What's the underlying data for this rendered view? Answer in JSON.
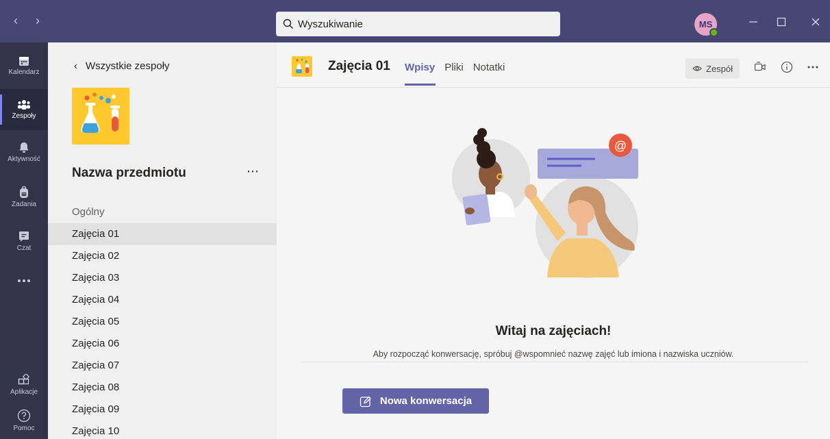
{
  "search": {
    "placeholder": "Wyszukiwanie"
  },
  "user": {
    "initials": "MS"
  },
  "rail": {
    "items": [
      {
        "label": "Kalendarz",
        "icon": "calendar-icon"
      },
      {
        "label": "Zespoły",
        "icon": "teams-icon",
        "active": true
      },
      {
        "label": "Aktywność",
        "icon": "bell-icon"
      },
      {
        "label": "Zadania",
        "icon": "backpack-icon"
      },
      {
        "label": "Czat",
        "icon": "chat-icon"
      },
      {
        "label": "Aplikacje",
        "icon": "apps-icon"
      },
      {
        "label": "Pomoc",
        "icon": "help-icon"
      }
    ]
  },
  "panel": {
    "back_label": "Wszystkie zespoły",
    "team_name": "Nazwa przedmiotu",
    "channels": [
      "Ogólny",
      "Zajęcia 01",
      "Zajęcia 02",
      "Zajęcia 03",
      "Zajęcia 04",
      "Zajęcia 05",
      "Zajęcia 06",
      "Zajęcia 07",
      "Zajęcia 08",
      "Zajęcia 09",
      "Zajęcia 10"
    ],
    "active_channel": "Zajęcia 01"
  },
  "main": {
    "channel_title": "Zajęcia 01",
    "tabs": [
      "Wpisy",
      "Pliki",
      "Notatki"
    ],
    "team_button": "Zespół",
    "welcome_title": "Witaj na zajęciach!",
    "welcome_text": "Aby rozpocząć konwersację, spróbuj @wspomnieć nazwę zajęć lub imiona i nazwiska uczniów.",
    "new_conversation": "Nowa konwersacja"
  },
  "colors": {
    "accent": "#6264a7",
    "titlebar": "#464775",
    "rail": "#33344a",
    "team_logo": "#ffc82c"
  }
}
